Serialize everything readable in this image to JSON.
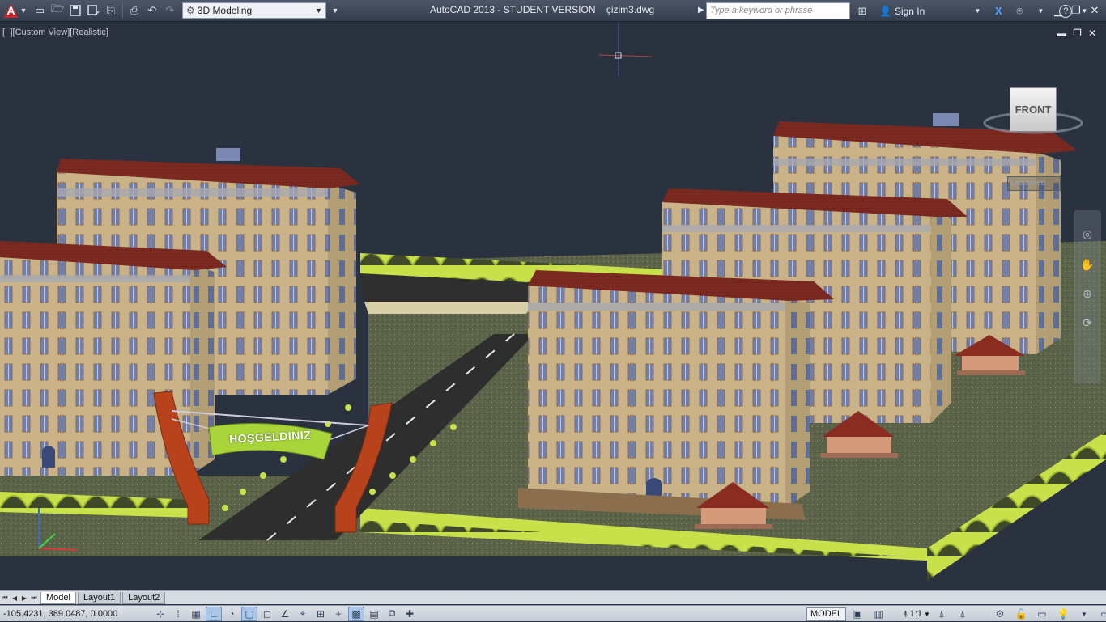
{
  "titlebar": {
    "workspace": "3D Modeling",
    "title": "AutoCAD 2013 - STUDENT VERSION    çizim3.dwg",
    "search_placeholder": "Type a keyword or phrase",
    "sign_in": "Sign In"
  },
  "viewport": {
    "label": "[−][Custom View][Realistic]",
    "viewcube_face": "FRONT",
    "ucs_name": "Unnamed",
    "sign_text": "HOŞGELDINIZ"
  },
  "layout_tabs": [
    "Model",
    "Layout1",
    "Layout2"
  ],
  "statusbar": {
    "coords": "-105.4231, 389.0487, 0.0000",
    "model": "MODEL",
    "annotation_scale": "1:1"
  },
  "colors": {
    "background": "#2b323f",
    "building_wall": "#c9b287",
    "roof": "#7b2a22",
    "lawn": "#6f7a55",
    "hedge": "#c8e04a",
    "road": "#2e2e2e"
  }
}
